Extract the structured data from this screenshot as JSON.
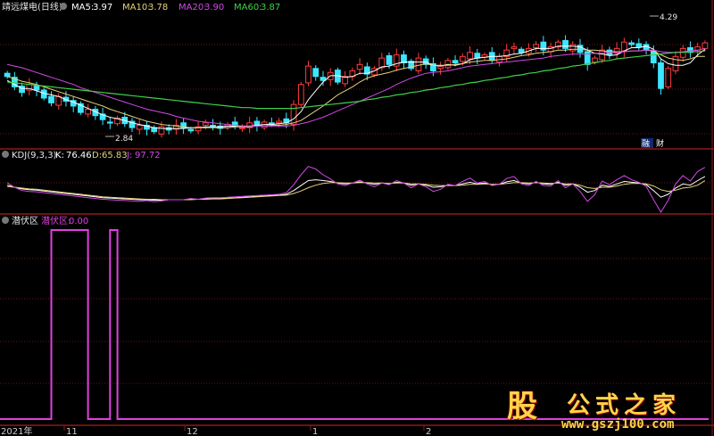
{
  "header": {
    "stock_name": "靖远煤电(日线)",
    "ma": [
      {
        "label": "MA5:",
        "value": "3.97",
        "color": "#ffffff"
      },
      {
        "label": "MA10:",
        "value": "3.78",
        "color": "#e6d27a"
      },
      {
        "label": "MA20:",
        "value": "3.90",
        "color": "#d24ae6"
      },
      {
        "label": "MA60:",
        "value": "3.87",
        "color": "#3fd04a"
      }
    ]
  },
  "kdj_header": {
    "name": "KDJ(9,3,3)",
    "k_label": "K:",
    "k_value": "76.46",
    "d_label": "D:",
    "d_value": "65.83",
    "j_label": "J:",
    "j_value": "97.72"
  },
  "qfq_header": {
    "name": "潜伏区",
    "series_label": "潜伏区:",
    "series_value": "0.00"
  },
  "annotations": {
    "high": "4.29",
    "low": "2.84",
    "tag1": "融",
    "tag2": "财"
  },
  "x_axis": {
    "labels": [
      "2021年",
      "11",
      "12",
      "1",
      "2"
    ]
  },
  "watermark": {
    "logo": "股",
    "title": "公式之家",
    "url": "www.gszj100.com"
  },
  "colors": {
    "up": "#ff3c3c",
    "down": "#3ce6ff",
    "ma5": "#ffffff",
    "ma10": "#e6d27a",
    "ma20": "#d24ae6",
    "ma60": "#3fd04a",
    "k": "#ffffff",
    "d": "#e6d27a",
    "j": "#d24ae6",
    "qfq": "#e040e0",
    "grid": "#8b1a1a"
  },
  "chart_data": [
    {
      "type": "candlestick",
      "title": "靖远煤电(日线)",
      "ylim": [
        2.7,
        4.35
      ],
      "annotations": [
        {
          "text": "4.29",
          "at": "high",
          "value": 4.29
        },
        {
          "text": "2.84",
          "at": "low",
          "value": 2.84
        }
      ],
      "close": [
        3.55,
        3.42,
        3.35,
        3.45,
        3.38,
        3.28,
        3.22,
        3.3,
        3.24,
        3.18,
        3.1,
        3.14,
        3.06,
        3.01,
        2.97,
        3.03,
        2.96,
        2.91,
        2.94,
        2.89,
        2.86,
        2.92,
        2.88,
        2.94,
        2.91,
        2.87,
        2.92,
        2.97,
        2.94,
        2.9,
        2.95,
        2.93,
        2.91,
        2.97,
        2.94,
        2.98,
        2.96,
        2.99,
        2.97,
        3.2,
        3.45,
        3.68,
        3.55,
        3.5,
        3.6,
        3.48,
        3.55,
        3.62,
        3.7,
        3.58,
        3.65,
        3.78,
        3.7,
        3.82,
        3.72,
        3.65,
        3.78,
        3.7,
        3.62,
        3.68,
        3.75,
        3.72,
        3.8,
        3.85,
        3.78,
        3.82,
        3.75,
        3.8,
        3.88,
        3.92,
        3.85,
        3.9,
        3.95,
        3.88,
        3.92,
        3.98,
        3.9,
        3.95,
        3.85,
        3.7,
        3.78,
        3.88,
        3.82,
        3.9,
        3.98,
        3.95,
        3.92,
        3.88,
        3.72,
        3.4,
        3.65,
        3.8,
        3.9,
        3.85,
        3.92,
        3.97
      ],
      "series": [
        {
          "name": "MA5",
          "values": [
            3.5,
            3.45,
            3.4,
            3.4,
            3.37,
            3.34,
            3.32,
            3.3,
            3.26,
            3.23,
            3.19,
            3.15,
            3.11,
            3.07,
            3.04,
            3.02,
            3.0,
            2.97,
            2.95,
            2.93,
            2.91,
            2.9,
            2.9,
            2.9,
            2.9,
            2.91,
            2.91,
            2.92,
            2.92,
            2.92,
            2.93,
            2.93,
            2.93,
            2.93,
            2.94,
            2.95,
            2.95,
            2.96,
            2.97,
            3.02,
            3.11,
            3.26,
            3.37,
            3.48,
            3.56,
            3.56,
            3.54,
            3.55,
            3.59,
            3.59,
            3.62,
            3.67,
            3.68,
            3.71,
            3.73,
            3.73,
            3.73,
            3.73,
            3.69,
            3.68,
            3.7,
            3.69,
            3.71,
            3.76,
            3.78,
            3.79,
            3.8,
            3.8,
            3.81,
            3.83,
            3.84,
            3.87,
            3.9,
            3.9,
            3.9,
            3.93,
            3.93,
            3.93,
            3.92,
            3.88,
            3.84,
            3.83,
            3.81,
            3.82,
            3.87,
            3.91,
            3.91,
            3.93,
            3.89,
            3.77,
            3.71,
            3.69,
            3.69,
            3.72,
            3.82,
            3.89
          ]
        },
        {
          "name": "MA10",
          "values": [
            3.55,
            3.52,
            3.49,
            3.47,
            3.45,
            3.42,
            3.39,
            3.36,
            3.33,
            3.3,
            3.27,
            3.24,
            3.21,
            3.18,
            3.14,
            3.11,
            3.08,
            3.05,
            3.02,
            2.99,
            2.97,
            2.95,
            2.94,
            2.93,
            2.92,
            2.91,
            2.91,
            2.91,
            2.91,
            2.91,
            2.91,
            2.92,
            2.92,
            2.92,
            2.93,
            2.93,
            2.94,
            2.94,
            2.95,
            2.97,
            3.0,
            3.06,
            3.12,
            3.18,
            3.25,
            3.32,
            3.37,
            3.42,
            3.48,
            3.53,
            3.56,
            3.58,
            3.6,
            3.63,
            3.65,
            3.67,
            3.69,
            3.71,
            3.69,
            3.69,
            3.69,
            3.7,
            3.71,
            3.73,
            3.74,
            3.75,
            3.75,
            3.76,
            3.77,
            3.79,
            3.81,
            3.82,
            3.84,
            3.85,
            3.86,
            3.88,
            3.88,
            3.89,
            3.89,
            3.88,
            3.88,
            3.87,
            3.86,
            3.86,
            3.86,
            3.87,
            3.87,
            3.88,
            3.87,
            3.82,
            3.78,
            3.76,
            3.75,
            3.77,
            3.8,
            3.8
          ]
        },
        {
          "name": "MA20",
          "values": [
            3.7,
            3.68,
            3.66,
            3.63,
            3.6,
            3.57,
            3.54,
            3.51,
            3.48,
            3.45,
            3.41,
            3.38,
            3.35,
            3.32,
            3.29,
            3.26,
            3.23,
            3.2,
            3.17,
            3.14,
            3.12,
            3.1,
            3.08,
            3.05,
            3.03,
            3.01,
            2.99,
            2.98,
            2.97,
            2.96,
            2.95,
            2.94,
            2.93,
            2.93,
            2.93,
            2.93,
            2.93,
            2.93,
            2.93,
            2.94,
            2.96,
            2.98,
            3.01,
            3.04,
            3.08,
            3.12,
            3.16,
            3.2,
            3.24,
            3.28,
            3.32,
            3.36,
            3.4,
            3.45,
            3.49,
            3.53,
            3.56,
            3.59,
            3.6,
            3.61,
            3.62,
            3.64,
            3.66,
            3.68,
            3.69,
            3.7,
            3.71,
            3.72,
            3.73,
            3.74,
            3.75,
            3.76,
            3.77,
            3.78,
            3.8,
            3.81,
            3.82,
            3.83,
            3.83,
            3.83,
            3.84,
            3.84,
            3.85,
            3.85,
            3.86,
            3.87,
            3.87,
            3.88,
            3.88,
            3.86,
            3.85,
            3.85,
            3.86,
            3.87,
            3.88,
            3.9
          ]
        },
        {
          "name": "MA60",
          "values": [
            3.48,
            3.47,
            3.46,
            3.45,
            3.44,
            3.43,
            3.42,
            3.41,
            3.4,
            3.39,
            3.38,
            3.37,
            3.36,
            3.35,
            3.34,
            3.33,
            3.32,
            3.31,
            3.3,
            3.29,
            3.28,
            3.27,
            3.26,
            3.25,
            3.24,
            3.23,
            3.22,
            3.21,
            3.2,
            3.19,
            3.18,
            3.17,
            3.16,
            3.16,
            3.15,
            3.15,
            3.15,
            3.15,
            3.15,
            3.15,
            3.16,
            3.17,
            3.18,
            3.19,
            3.2,
            3.21,
            3.22,
            3.23,
            3.24,
            3.26,
            3.27,
            3.29,
            3.3,
            3.32,
            3.33,
            3.35,
            3.36,
            3.38,
            3.39,
            3.41,
            3.42,
            3.44,
            3.45,
            3.47,
            3.48,
            3.5,
            3.51,
            3.53,
            3.54,
            3.56,
            3.57,
            3.59,
            3.6,
            3.62,
            3.63,
            3.65,
            3.66,
            3.68,
            3.69,
            3.71,
            3.72,
            3.74,
            3.75,
            3.77,
            3.78,
            3.79,
            3.8,
            3.81,
            3.82,
            3.83,
            3.84,
            3.85,
            3.85,
            3.86,
            3.86,
            3.87
          ]
        }
      ]
    },
    {
      "type": "line",
      "title": "KDJ(9,3,3)",
      "ylim": [
        -10,
        110
      ],
      "series": [
        {
          "name": "K",
          "values": [
            55,
            50,
            46,
            44,
            43,
            41,
            39,
            37,
            35,
            33,
            31,
            29,
            27,
            25,
            24,
            23,
            22,
            21,
            20,
            20,
            19,
            19,
            20,
            20,
            20,
            21,
            21,
            22,
            23,
            23,
            24,
            25,
            26,
            27,
            28,
            29,
            30,
            31,
            33,
            42,
            54,
            66,
            68,
            66,
            64,
            60,
            58,
            60,
            63,
            60,
            57,
            60,
            58,
            62,
            60,
            55,
            58,
            55,
            50,
            51,
            55,
            54,
            58,
            62,
            58,
            60,
            56,
            57,
            63,
            66,
            60,
            58,
            62,
            58,
            57,
            62,
            55,
            58,
            50,
            38,
            42,
            55,
            52,
            58,
            64,
            62,
            60,
            56,
            42,
            26,
            33,
            48,
            58,
            55,
            66,
            76
          ]
        },
        {
          "name": "D",
          "values": [
            52,
            50,
            48,
            46,
            45,
            43,
            41,
            39,
            37,
            35,
            33,
            31,
            29,
            27,
            26,
            25,
            24,
            23,
            22,
            21,
            21,
            20,
            20,
            20,
            20,
            20,
            21,
            21,
            22,
            22,
            23,
            24,
            25,
            26,
            27,
            28,
            29,
            30,
            31,
            35,
            41,
            49,
            55,
            59,
            61,
            61,
            60,
            60,
            61,
            61,
            60,
            60,
            59,
            60,
            60,
            58,
            58,
            57,
            55,
            54,
            54,
            54,
            55,
            57,
            57,
            58,
            57,
            57,
            59,
            61,
            61,
            60,
            61,
            60,
            59,
            60,
            58,
            58,
            55,
            49,
            47,
            50,
            50,
            53,
            57,
            59,
            59,
            58,
            53,
            44,
            40,
            43,
            48,
            50,
            55,
            65.83
          ]
        },
        {
          "name": "J",
          "values": [
            61,
            50,
            42,
            40,
            39,
            37,
            35,
            33,
            31,
            29,
            27,
            25,
            23,
            21,
            20,
            19,
            18,
            17,
            16,
            18,
            15,
            17,
            20,
            20,
            20,
            23,
            21,
            24,
            25,
            25,
            26,
            27,
            28,
            29,
            30,
            31,
            32,
            33,
            37,
            56,
            80,
            100,
            94,
            80,
            70,
            58,
            54,
            60,
            67,
            58,
            51,
            60,
            56,
            66,
            60,
            49,
            58,
            51,
            40,
            45,
            57,
            54,
            64,
            72,
            60,
            64,
            54,
            57,
            71,
            76,
            58,
            54,
            64,
            54,
            53,
            66,
            49,
            58,
            40,
            16,
            32,
            65,
            56,
            68,
            78,
            68,
            62,
            52,
            20,
            -10,
            19,
            58,
            78,
            65,
            88,
            97.72
          ]
        }
      ]
    },
    {
      "type": "line",
      "title": "潜伏区",
      "ylim": [
        0,
        1
      ],
      "series": [
        {
          "name": "潜伏区",
          "values": [
            0,
            0,
            0,
            0,
            0,
            0,
            1,
            1,
            1,
            1,
            1,
            0,
            0,
            0,
            1,
            0,
            0,
            0,
            0,
            0,
            0,
            0,
            0,
            0,
            0,
            0,
            0,
            0,
            0,
            0,
            0,
            0,
            0,
            0,
            0,
            0,
            0,
            0,
            0,
            0,
            0,
            0,
            0,
            0,
            0,
            0,
            0,
            0,
            0,
            0,
            0,
            0,
            0,
            0,
            0,
            0,
            0,
            0,
            0,
            0,
            0,
            0,
            0,
            0,
            0,
            0,
            0,
            0,
            0,
            0,
            0,
            0,
            0,
            0,
            0,
            0,
            0,
            0,
            0,
            0,
            0,
            0,
            0,
            0,
            0,
            0,
            0,
            0,
            0,
            0,
            0,
            0,
            0,
            0,
            0,
            0
          ]
        }
      ]
    }
  ]
}
